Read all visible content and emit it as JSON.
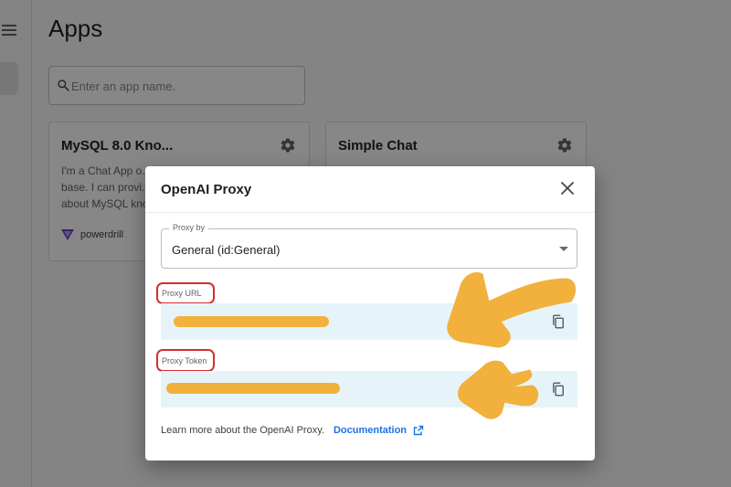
{
  "page": {
    "title": "Apps",
    "search": {
      "placeholder": "Enter an app name.",
      "value": ""
    }
  },
  "apps": [
    {
      "title": "MySQL 8.0 Kno...",
      "description": "I'm a Chat App o... base. I can provi... about MySQL kno...",
      "owner": "powerdrill",
      "icon": "gear-icon"
    },
    {
      "title": "Simple Chat",
      "description": "",
      "owner": "",
      "icon": "gear-icon"
    }
  ],
  "dialog": {
    "title": "OpenAI Proxy",
    "proxy_by": {
      "label": "Proxy by",
      "value": "General (id:General)"
    },
    "proxy_url": {
      "label": "Proxy URL",
      "value": ""
    },
    "proxy_token": {
      "label": "Proxy Token",
      "value": ""
    },
    "footer_text": "Learn more about the OpenAI Proxy.",
    "doc_link": "Documentation"
  },
  "colors": {
    "accent": "#1a73e8",
    "highlight_circle": "#d32f2f",
    "redaction": "#f2b13c",
    "field_background": "#e6f4fa"
  }
}
